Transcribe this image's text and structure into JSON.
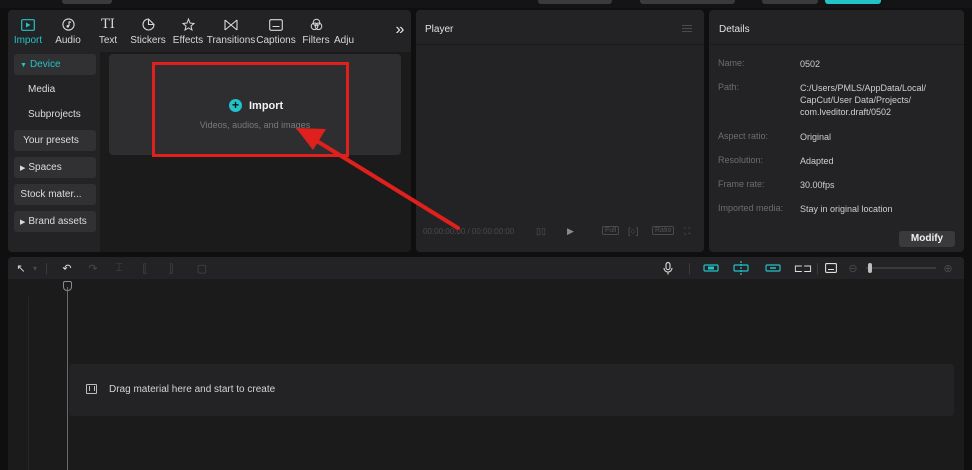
{
  "media_tabs": [
    {
      "label": "Import",
      "icon": "import-icon"
    },
    {
      "label": "Audio",
      "icon": "audio-icon"
    },
    {
      "label": "Text",
      "icon": "text-icon"
    },
    {
      "label": "Stickers",
      "icon": "sticker-icon"
    },
    {
      "label": "Effects",
      "icon": "effects-icon"
    },
    {
      "label": "Transitions",
      "icon": "transitions-icon"
    },
    {
      "label": "Captions",
      "icon": "captions-icon"
    },
    {
      "label": "Filters",
      "icon": "filters-icon"
    },
    {
      "label": "Adju",
      "icon": "adjust-icon"
    }
  ],
  "tabs_more": "»",
  "sidebar": {
    "device": "Device",
    "media": "Media",
    "subprojects": "Subprojects",
    "your_presets": "Your presets",
    "spaces": "Spaces",
    "stock": "Stock mater...",
    "brand_assets": "Brand assets"
  },
  "import_card": {
    "label": "Import",
    "subtitle": "Videos, audios, and images"
  },
  "player": {
    "title": "Player",
    "timecode": "00:00:00:00 / 00:00:00:00",
    "full": "Full",
    "ratio": "Ratio"
  },
  "details": {
    "title": "Details",
    "rows": [
      {
        "key": "Name:",
        "value": "0502"
      },
      {
        "key": "Path:",
        "value": "C:/Users/PMLS/AppData/Local/ CapCut/User Data/Projects/ com.lveditor.draft/0502"
      },
      {
        "key": "Aspect ratio:",
        "value": "Original"
      },
      {
        "key": "Resolution:",
        "value": "Adapted"
      },
      {
        "key": "Frame rate:",
        "value": "30.00fps"
      },
      {
        "key": "Imported media:",
        "value": "Stay in original location"
      }
    ],
    "modify": "Modify"
  },
  "timeline": {
    "drop_hint": "Drag material here and start to create"
  },
  "colors": {
    "accent": "#21c3c9",
    "annotation": "#e0201c",
    "panel": "#232325",
    "background": "#0f0f10"
  }
}
